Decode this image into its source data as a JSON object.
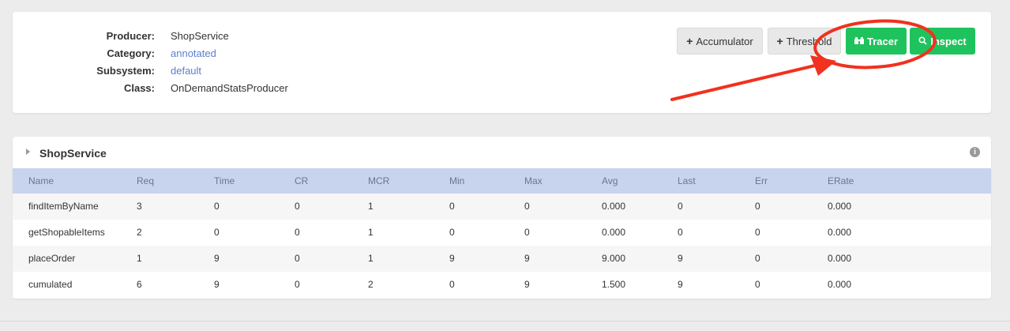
{
  "producer_info": {
    "rows": [
      {
        "label": "Producer:",
        "value": "ShopService",
        "link": false
      },
      {
        "label": "Category:",
        "value": "annotated",
        "link": true
      },
      {
        "label": "Subsystem:",
        "value": "default",
        "link": true
      },
      {
        "label": "Class:",
        "value": "OnDemandStatsProducer",
        "link": false
      }
    ]
  },
  "actions": {
    "accumulator": {
      "icon": "+",
      "label": "Accumulator"
    },
    "threshold": {
      "icon": "+",
      "label": "Threshold"
    },
    "tracer": {
      "icon": "binoculars-icon",
      "label": "Tracer"
    },
    "inspect": {
      "icon": "search-icon",
      "label": "Inspect"
    }
  },
  "panel": {
    "title": "ShopService",
    "columns": [
      "Name",
      "Req",
      "Time",
      "CR",
      "MCR",
      "Min",
      "Max",
      "Avg",
      "Last",
      "Err",
      "ERate"
    ],
    "rows": [
      [
        "findItemByName",
        "3",
        "0",
        "0",
        "1",
        "0",
        "0",
        "0.000",
        "0",
        "0",
        "0.000"
      ],
      [
        "getShopableItems",
        "2",
        "0",
        "0",
        "1",
        "0",
        "0",
        "0.000",
        "0",
        "0",
        "0.000"
      ],
      [
        "placeOrder",
        "1",
        "9",
        "0",
        "1",
        "9",
        "9",
        "9.000",
        "9",
        "0",
        "0.000"
      ],
      [
        "cumulated",
        "6",
        "9",
        "0",
        "2",
        "0",
        "9",
        "1.500",
        "9",
        "0",
        "0.000"
      ]
    ]
  },
  "colors": {
    "accent_green": "#1fc35d",
    "table_header": "#c8d4ee",
    "link": "#5b7fcf",
    "annotation_red": "#f0321e"
  }
}
